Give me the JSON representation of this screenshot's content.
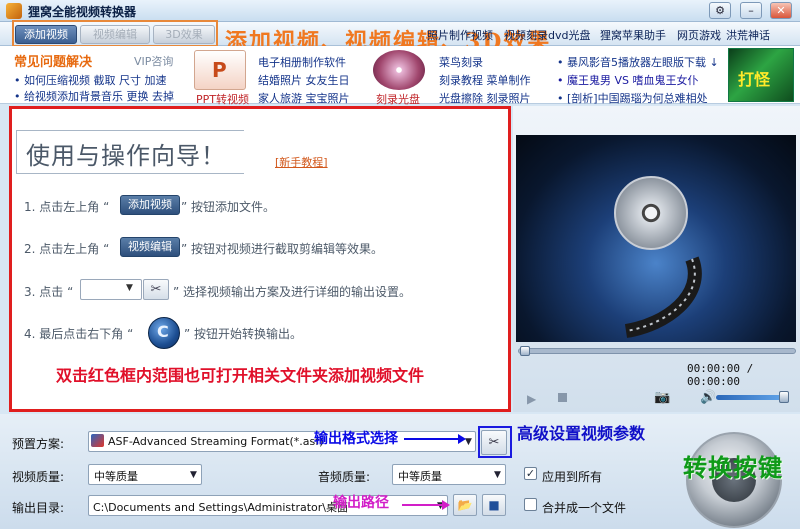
{
  "window": {
    "title": "狸窝全能视频转换器",
    "controls": [
      "⚙",
      "–",
      "✕"
    ]
  },
  "toolbar": {
    "add_video": "添加视频",
    "edit_video": "视频编辑",
    "effect_3d": "3D效果",
    "annotation": "添加视频、视频编辑、3D效果",
    "links": [
      "照片制作视频",
      "视频刻录dvd光盘",
      "狸窝苹果助手",
      "网页游戏",
      "洪荒神话"
    ]
  },
  "promo": {
    "faq_title": "常见问题解决",
    "vip": "VIP咨询",
    "faq_lines": [
      "• 如何压缩视频  截取  尺寸  加速",
      "• 给视频添加背景音乐  更换  去掉"
    ],
    "ppt_label": "PPT转视频",
    "ppt_letter": "P",
    "middle_links": [
      "电子相册制作软件",
      "结婚照片  女友生日",
      "家人旅游  宝宝照片"
    ],
    "disc_label": "刻录光盘",
    "disc_links": [
      "菜鸟刻录",
      "刻录教程  菜单制作",
      "光盘擦除  刻录照片"
    ],
    "right_links": [
      {
        "text": "• 暴风影音5播放器左眼版下载 ↓",
        "color": "#14348a"
      },
      {
        "text": "• 魔王鬼男 VS 嗜血鬼王女仆",
        "color": "#1a1aa0"
      },
      {
        "text": "• [剖析]中国踢瑙为何总难相处",
        "color": "#14348a"
      }
    ],
    "game_text": "打怪"
  },
  "guide": {
    "title": "使用与操作向导！",
    "new_tutorial": "[新手教程]",
    "step1_pre": "1. 点击左上角 “",
    "step1_btn": "添加视频",
    "step1_post": "” 按钮添加文件。",
    "step2_pre": "2. 点击左上角 “",
    "step2_btn": "视频编辑",
    "step2_post": "” 按钮对视频进行截取剪编辑等效果。",
    "step3_pre": "3. 点击 “",
    "step3_post": "” 选择视频输出方案及进行详细的输出设置。",
    "step4_pre": "4. 最后点击右下角 “",
    "step4_post": "” 按钮开始转换输出。",
    "start_glyph": "C",
    "annotation": "双击红色框内范围也可打开相关文件夹添加视频文件"
  },
  "player": {
    "time": "00:00:00 / 00:00:00",
    "play_icon": "▶",
    "camera_icon": "📷",
    "volume_icon": "🔊",
    "seek_progress": 0,
    "volume_level": 0.95
  },
  "settings": {
    "preset_label": "预置方案:",
    "preset_value": "ASF-Advanced Streaming Format(*.asf)",
    "format_annotation": "输出格式选择",
    "advanced_annotation": "高级设置视频参数",
    "video_quality_label": "视频质量:",
    "video_quality_value": "中等质量",
    "audio_quality_label": "音频质量:",
    "audio_quality_value": "中等质量",
    "apply_all_label": "应用到所有",
    "apply_all_checked": true,
    "output_dir_label": "输出目录:",
    "output_dir_value": "C:\\Documents and Settings\\Administrator\\桌面",
    "path_annotation": "输出路径",
    "merge_label": "合并成一个文件",
    "merge_checked": false,
    "convert_annotation": "转换按键",
    "tool_glyph": "✂",
    "folder_glyph": "📂",
    "open_glyph": "■",
    "check_mark": "✓"
  }
}
